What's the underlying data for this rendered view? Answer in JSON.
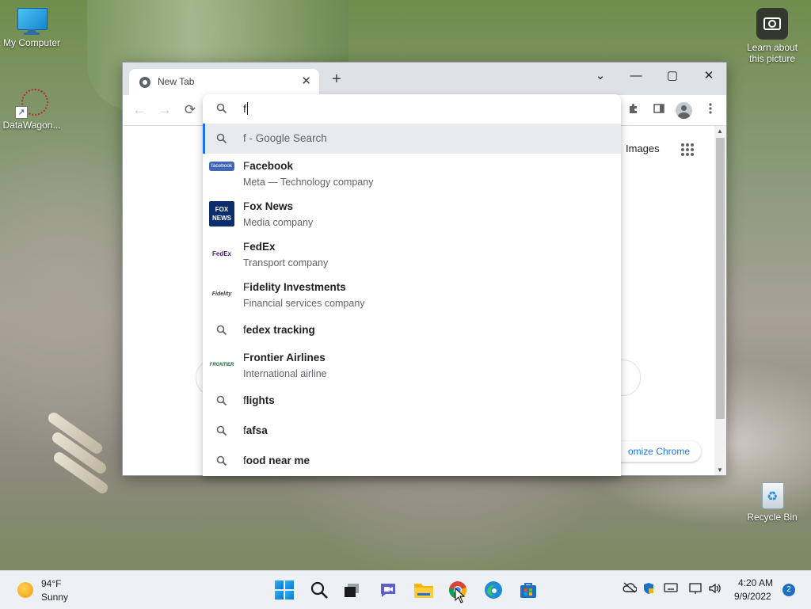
{
  "desktop": {
    "icons": [
      {
        "label": "My Computer"
      },
      {
        "label": "DataWagon..."
      },
      {
        "label": "Learn about this picture"
      },
      {
        "label": "Recycle Bin"
      }
    ]
  },
  "browser": {
    "tab_title": "New Tab",
    "tab_close": "✕",
    "new_tab": "+",
    "window_controls": {
      "dropdown": "⌄",
      "minimize": "—",
      "maximize": "▢",
      "close": "✕"
    },
    "nav": {
      "back": "←",
      "forward": "→",
      "reload": "⟳"
    },
    "page": {
      "images_link": "Images",
      "customize_label": "Customize Chrome",
      "customize_visible": "omize Chrome"
    },
    "omnibox": {
      "query": "f",
      "suggestions": [
        {
          "type": "search",
          "typed": "f",
          "text": " - Google Search",
          "selected": true
        },
        {
          "type": "entity",
          "logo": "facebook",
          "typed": "F",
          "rest": "acebook",
          "sub": "Meta — Technology company"
        },
        {
          "type": "entity",
          "logo": "FOX NEWS",
          "typed": "F",
          "rest": "ox News",
          "sub": "Media company"
        },
        {
          "type": "entity",
          "logo": "FedEx",
          "typed": "F",
          "rest": "edEx",
          "sub": "Transport company"
        },
        {
          "type": "entity",
          "logo": "Fidelity",
          "typed": "F",
          "rest": "idelity Investments",
          "sub": "Financial services company"
        },
        {
          "type": "search",
          "typed": "f",
          "rest": "edex tracking"
        },
        {
          "type": "entity",
          "logo": "FRONTIER",
          "typed": "F",
          "rest": "rontier Airlines",
          "sub": "International airline"
        },
        {
          "type": "search",
          "typed": "f",
          "rest": "lights"
        },
        {
          "type": "search",
          "typed": "f",
          "rest": "afsa"
        },
        {
          "type": "search",
          "typed": "f",
          "rest": "ood near me"
        }
      ]
    }
  },
  "taskbar": {
    "weather": {
      "temp": "94°F",
      "condition": "Sunny"
    },
    "clock": {
      "time": "4:20 AM",
      "date": "9/9/2022"
    },
    "notifications": "2",
    "apps": [
      "start",
      "search",
      "task-view",
      "teams-chat",
      "file-explorer",
      "chrome",
      "edge",
      "store"
    ]
  },
  "colors": {
    "accent": "#1a73e8",
    "titlebar": "#dee1e6",
    "taskbar": "#edf1f6",
    "selected_row": "#e8eaed"
  }
}
